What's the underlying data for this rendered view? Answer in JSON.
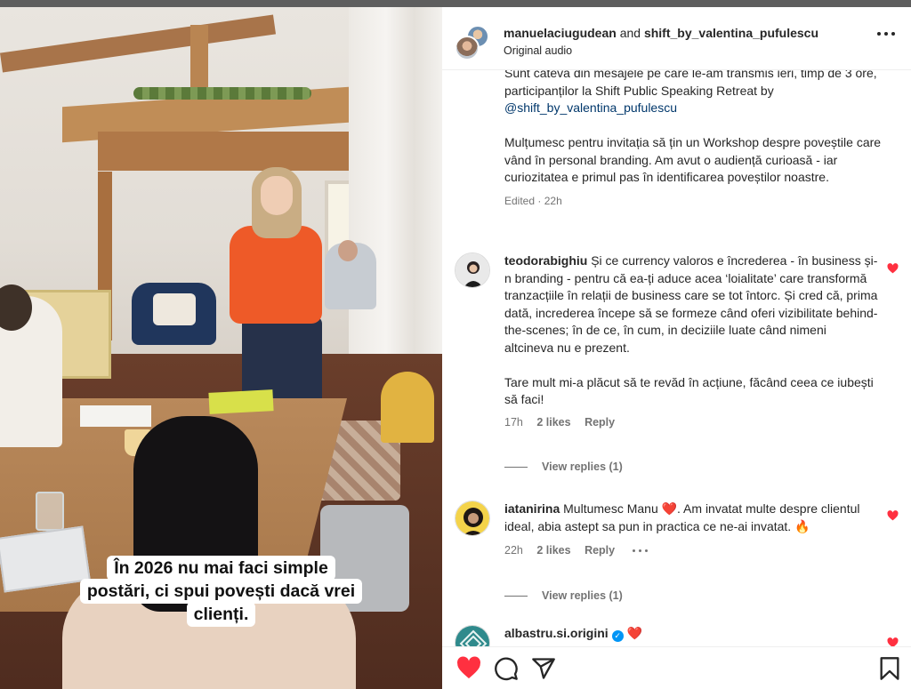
{
  "colors": {
    "accent_red": "#ff3040",
    "link_blue": "#00376b",
    "verified_blue": "#0095f6",
    "meta_gray": "#737373"
  },
  "video": {
    "caption_lines": [
      "În 2026 nu mai faci simple",
      "postări, ci spui povești dacă vrei",
      "clienți."
    ]
  },
  "header": {
    "user1": "manuelaciugudean",
    "joiner": "and",
    "user2": "shift_by_valentina_pufulescu",
    "audio": "Original audio",
    "more_icon": "more-horizontal-icon"
  },
  "caption": {
    "para1_text": "Sunt câteva din mesajele pe care le-am transmis ieri, timp de 3 ore, participanților la Shift Public Speaking Retreat by",
    "mention": "@shift_by_valentina_pufulescu",
    "para2": "Mulțumesc pentru invitația să țin un Workshop despre poveștile care vând în personal branding. Am avut o audiență curioasă - iar curiozitatea e primul pas în identificarea poveștilor noastre.",
    "edited": "Edited",
    "sep": "·",
    "time": "22h"
  },
  "comments": [
    {
      "username": "teodorabighiu",
      "text1": "Și ce currency valoros e încrederea - în business și-n branding - pentru că ea-ți aduce acea ‘loialitate’ care transformă tranzacțiile în relații de business care se tot întorc. Și cred că, prima dată, increderea începe să se formeze când oferi vizibilitate behind-the-scenes; în de ce, în cum, in deciziile luate când nimeni altcineva nu e prezent.",
      "text2": "Tare mult mi-a plăcut să te revăd în acțiune, făcând ceea ce iubești să faci!",
      "time": "17h",
      "likes": "2 likes",
      "reply": "Reply",
      "view_replies": "View replies (1)"
    },
    {
      "username": "iatanirina",
      "text1": "Multumesc Manu ❤️. Am invatat multe despre clientul ideal, abia astept sa pun in practica ce ne-ai invatat. 🔥",
      "time": "22h",
      "likes": "2 likes",
      "reply": "Reply",
      "view_replies": "View replies (1)"
    },
    {
      "username": "albastru.si.origini",
      "verified_mark": "✓",
      "text1": "❤️"
    }
  ],
  "actions": {
    "like_icon": "heart-filled-icon",
    "comment_icon": "comment-icon",
    "share_icon": "share-icon",
    "save_icon": "bookmark-icon"
  }
}
